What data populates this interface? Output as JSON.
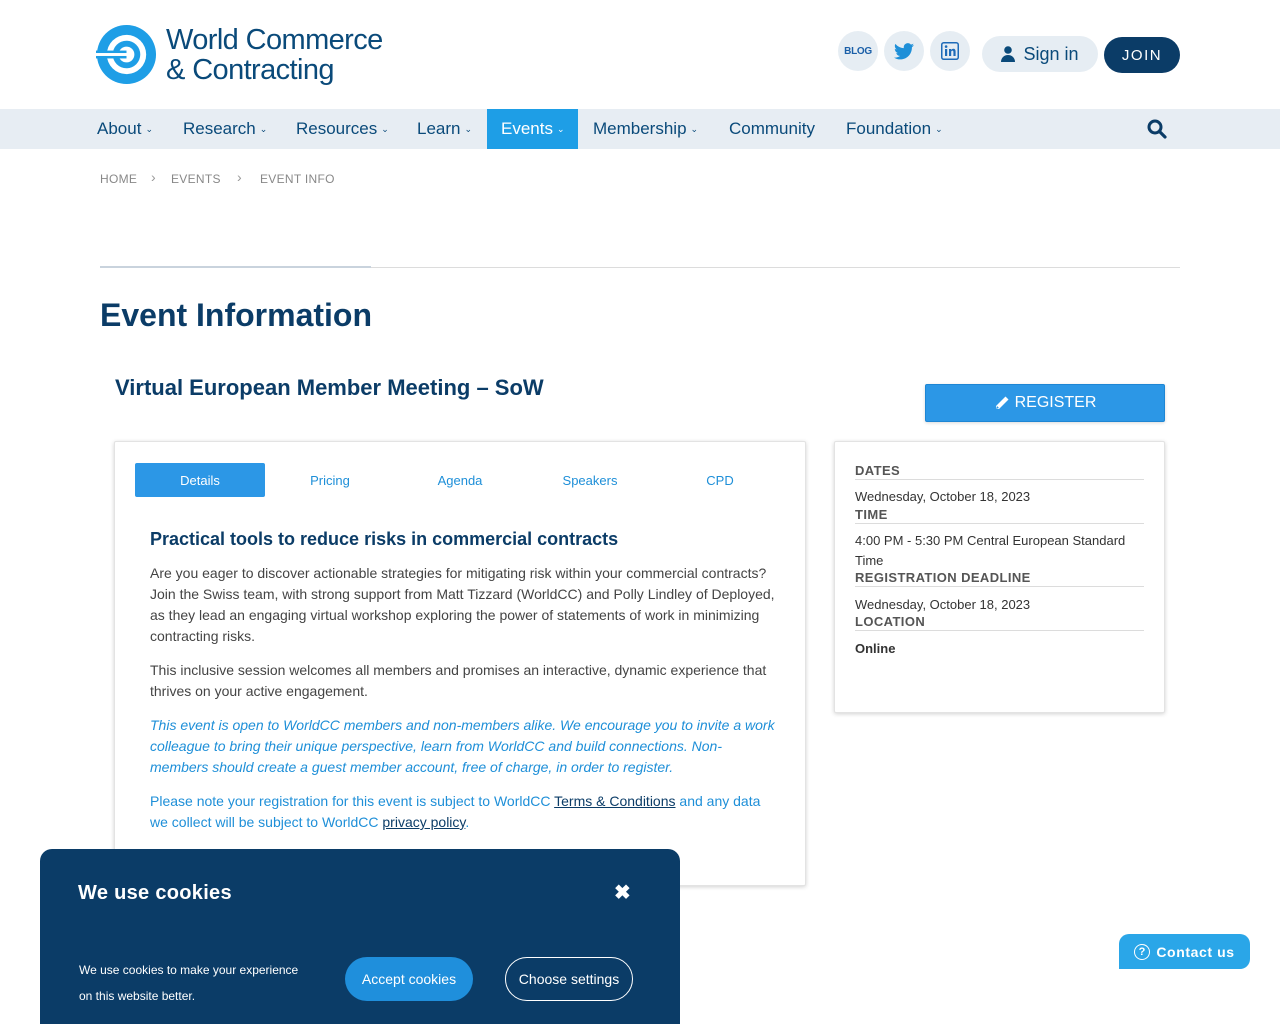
{
  "header": {
    "logo_line1": "World Commerce",
    "logo_line2": "& Contracting",
    "blog_label": "BLOG",
    "signin_label": "Sign in",
    "join_label": "JOIN",
    "social_icons": [
      "twitter-icon",
      "linkedin-icon"
    ]
  },
  "nav": {
    "items": [
      {
        "label": "About",
        "dropdown": true
      },
      {
        "label": "Research",
        "dropdown": true
      },
      {
        "label": "Resources",
        "dropdown": true
      },
      {
        "label": "Learn",
        "dropdown": true
      },
      {
        "label": "Events",
        "dropdown": true,
        "active": true
      },
      {
        "label": "Membership",
        "dropdown": true
      },
      {
        "label": "Community",
        "dropdown": false
      },
      {
        "label": "Foundation",
        "dropdown": true
      }
    ],
    "search_icon": "search-icon"
  },
  "breadcrumb": [
    "HOME",
    "EVENTS",
    "EVENT INFO"
  ],
  "page": {
    "title": "Event Information",
    "event_title": "Virtual European Member Meeting – SoW",
    "register_label": "REGISTER"
  },
  "tabs": [
    "Details",
    "Pricing",
    "Agenda",
    "Speakers",
    "CPD"
  ],
  "details": {
    "heading": "Practical tools to reduce risks in commercial contracts",
    "para1": "Are you eager to discover actionable strategies for mitigating risk within your commercial contracts? Join the Swiss team, with strong support from Matt Tizzard (WorldCC) and Polly Lindley of Deployed, as they lead an engaging virtual workshop exploring the power of statements of work in minimizing contracting risks.",
    "para2": "This inclusive session welcomes all members and promises an interactive, dynamic experience that thrives on your active engagement.",
    "para3": "This event is open to WorldCC members and non-members alike. We encourage you to invite a work colleague to bring their unique perspective, learn from WorldCC and build connections. Non-members should create a guest member account, free of charge, in order to register.",
    "note_pre": "Please note your registration for this event is subject to WorldCC ",
    "terms_link": "Terms & Conditions",
    "note_mid": " and any data we collect will be subject to WorldCC ",
    "privacy_link": "privacy policy",
    "note_end": "."
  },
  "sidebar": {
    "dates_label": "DATES",
    "dates_value": "Wednesday, October 18, 2023",
    "time_label": "TIME",
    "time_value": "4:00 PM - 5:30 PM Central European Standard Time",
    "deadline_label": "REGISTRATION DEADLINE",
    "deadline_value": "Wednesday, October 18, 2023",
    "location_label": "LOCATION",
    "location_value": "Online"
  },
  "cookie": {
    "title": "We use cookies",
    "text": "We use cookies to make your experience on this website better.",
    "accept_label": "Accept cookies",
    "settings_label": "Choose settings",
    "close_glyph": "✖"
  },
  "contact": {
    "label": "Contact us",
    "icon_glyph": "?"
  },
  "colors": {
    "brand_dark": "#0b3c67",
    "accent_blue": "#2c97e6",
    "nav_bg": "#e7edf3"
  }
}
